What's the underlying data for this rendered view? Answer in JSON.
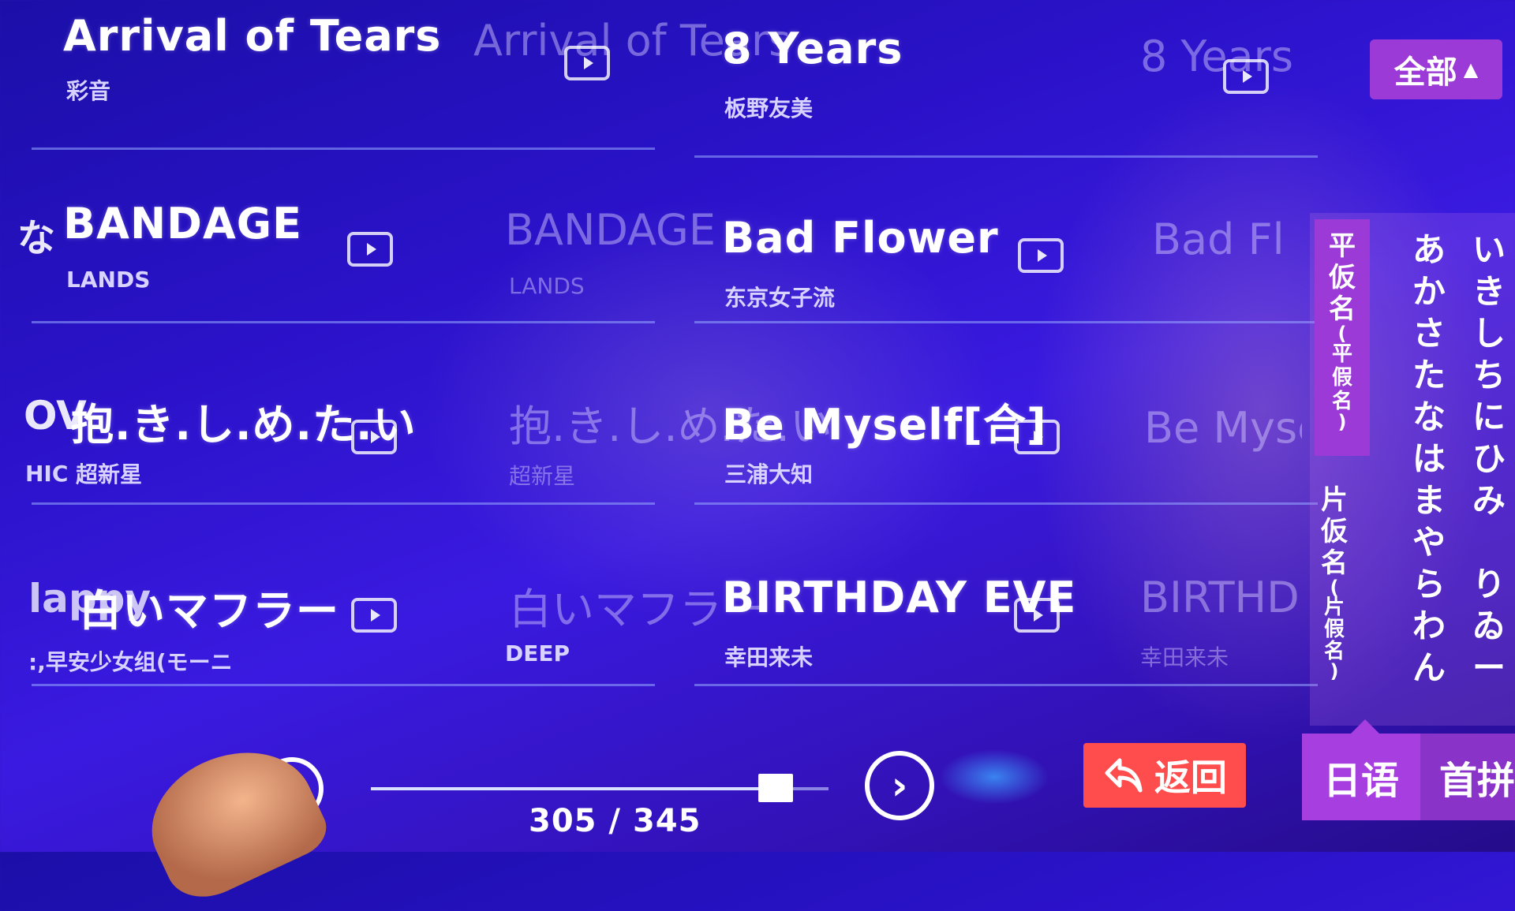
{
  "colors": {
    "background": "#2a12c8",
    "accent": "#9b3ad6",
    "back_button": "#ff4d4d",
    "divider": "#96aaff"
  },
  "songs": [
    {
      "title": "Arrival of Tears",
      "artist": "彩音"
    },
    {
      "title": "8 Years",
      "artist": "板野友美"
    },
    {
      "title": "BANDAGE",
      "artist": "LANDS"
    },
    {
      "title": "Bad Flower",
      "artist": "东京女子流"
    },
    {
      "title": "抱.き.し.め.た.い",
      "artist": "超新星"
    },
    {
      "title": "Be Myself[合]",
      "artist": "三浦大知"
    },
    {
      "title": "白いマフラー",
      "artist": "DEEP"
    },
    {
      "title": "BIRTHDAY EVE",
      "artist": "幸田来未"
    }
  ],
  "edge_fragments": {
    "row2_kana": "な",
    "row3_left": "OV",
    "row3_left_sub": "HIC",
    "row4_left": "lappy",
    "row4_left_sub": ":,早安少女组(モーニ"
  },
  "filter": {
    "label": "全部",
    "caret": "▲"
  },
  "kana_tabs": [
    {
      "label": "平仮名(平假名)",
      "chars": [
        "平",
        "仮",
        "名",
        "(",
        "平",
        "假",
        "名",
        ")"
      ],
      "active": true
    },
    {
      "label": "片仮名(片假名)",
      "chars": [
        "片",
        "仮",
        "名",
        "(",
        "片",
        "假",
        "名",
        ")"
      ],
      "active": false
    }
  ],
  "kana_columns": [
    [
      "あ",
      "か",
      "さ",
      "た",
      "な",
      "は",
      "ま",
      "や",
      "ら",
      "わ",
      "ん"
    ],
    [
      "い",
      "き",
      "し",
      "ち",
      "に",
      "ひ",
      "み",
      "",
      "り",
      "ゐ",
      "ー"
    ]
  ],
  "pagination": {
    "current": 305,
    "total": 345,
    "text": "305 / 345",
    "progress": 0.884
  },
  "back_button": {
    "label": "返回"
  },
  "lang_tabs": [
    {
      "label": "日语",
      "active": true
    },
    {
      "label": "首拼",
      "active": false
    }
  ],
  "icons": {
    "play": "play-icon",
    "next": "chevron-right-icon",
    "back": "return-arrow-icon",
    "prev": "circle-icon"
  }
}
